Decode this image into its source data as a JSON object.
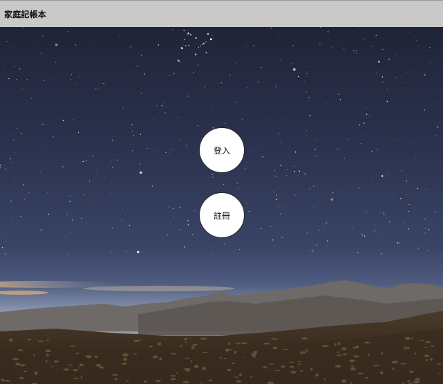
{
  "window": {
    "title": "家庭記帳本"
  },
  "actions": {
    "login_label": "登入",
    "register_label": "註冊"
  },
  "background": {
    "icon": "starry-night-mountain-background"
  }
}
